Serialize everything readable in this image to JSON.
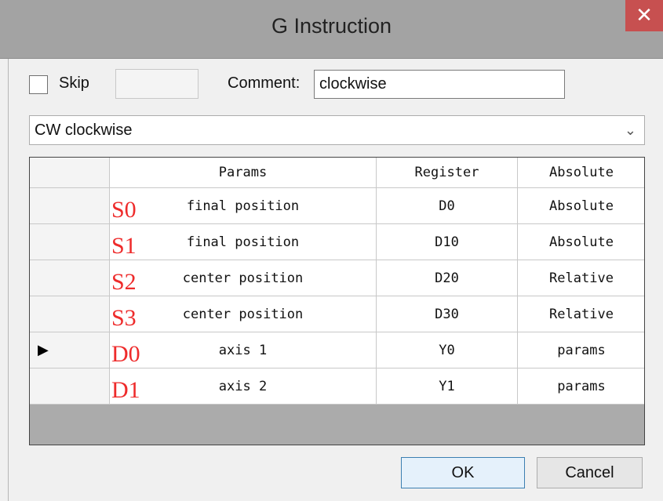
{
  "window": {
    "title": "G Instruction",
    "close_glyph": "✕"
  },
  "options": {
    "skip_label": "Skip",
    "skip_checked": false,
    "comment_label": "Comment:",
    "comment_value": "clockwise"
  },
  "mode_select": {
    "value": "CW clockwise",
    "chevron": "⌄"
  },
  "table": {
    "columns": [
      "",
      "Params",
      "Register",
      "Absolute"
    ],
    "current_row_marker": "▶",
    "rows": [
      {
        "tag": "S0",
        "param": "final position",
        "register": "D0",
        "mode": "Absolute",
        "current": false
      },
      {
        "tag": "S1",
        "param": "final position",
        "register": "D10",
        "mode": "Absolute",
        "current": false
      },
      {
        "tag": "S2",
        "param": "center position",
        "register": "D20",
        "mode": "Relative",
        "current": false
      },
      {
        "tag": "S3",
        "param": "center position",
        "register": "D30",
        "mode": "Relative",
        "current": false
      },
      {
        "tag": "D0",
        "param": "axis 1",
        "register": "Y0",
        "mode": "params",
        "current": true
      },
      {
        "tag": "D1",
        "param": "axis 2",
        "register": "Y1",
        "mode": "params",
        "current": false
      }
    ]
  },
  "buttons": {
    "ok": "OK",
    "cancel": "Cancel"
  },
  "colors": {
    "tag_red": "#ee2b2b",
    "close_red": "#c75050",
    "ok_border": "#3c7fb1"
  }
}
